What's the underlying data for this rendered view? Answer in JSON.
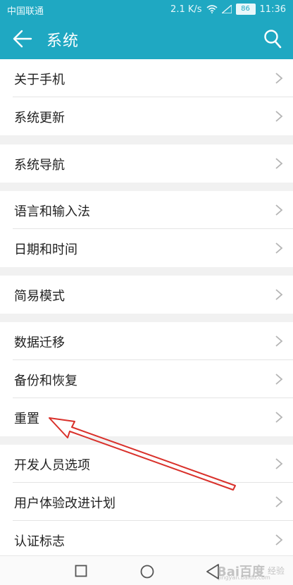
{
  "status_bar": {
    "carrier": "中国联通",
    "network_speed": "2.1 K/s",
    "battery_level": "86",
    "time": "11:36"
  },
  "app_bar": {
    "title": "系统"
  },
  "icons": {
    "back": "back-arrow-icon",
    "search": "search-icon",
    "chevron": "chevron-right-icon"
  },
  "groups": [
    {
      "items": [
        {
          "label": "关于手机"
        },
        {
          "label": "系统更新"
        }
      ]
    },
    {
      "items": [
        {
          "label": "系统导航"
        }
      ]
    },
    {
      "items": [
        {
          "label": "语言和输入法"
        },
        {
          "label": "日期和时间"
        }
      ]
    },
    {
      "items": [
        {
          "label": "简易模式"
        }
      ]
    },
    {
      "items": [
        {
          "label": "数据迁移"
        },
        {
          "label": "备份和恢复"
        },
        {
          "label": "重置"
        }
      ]
    },
    {
      "items": [
        {
          "label": "开发人员选项"
        },
        {
          "label": "用户体验改进计划"
        },
        {
          "label": "认证标志"
        }
      ]
    }
  ],
  "watermark": {
    "brand": "Bai百度",
    "sub": "经验",
    "url": "jingyan.baidu.com"
  },
  "colors": {
    "accent": "#1fa8c2",
    "annotation": "#d9312b",
    "background": "#f1f1f1"
  }
}
